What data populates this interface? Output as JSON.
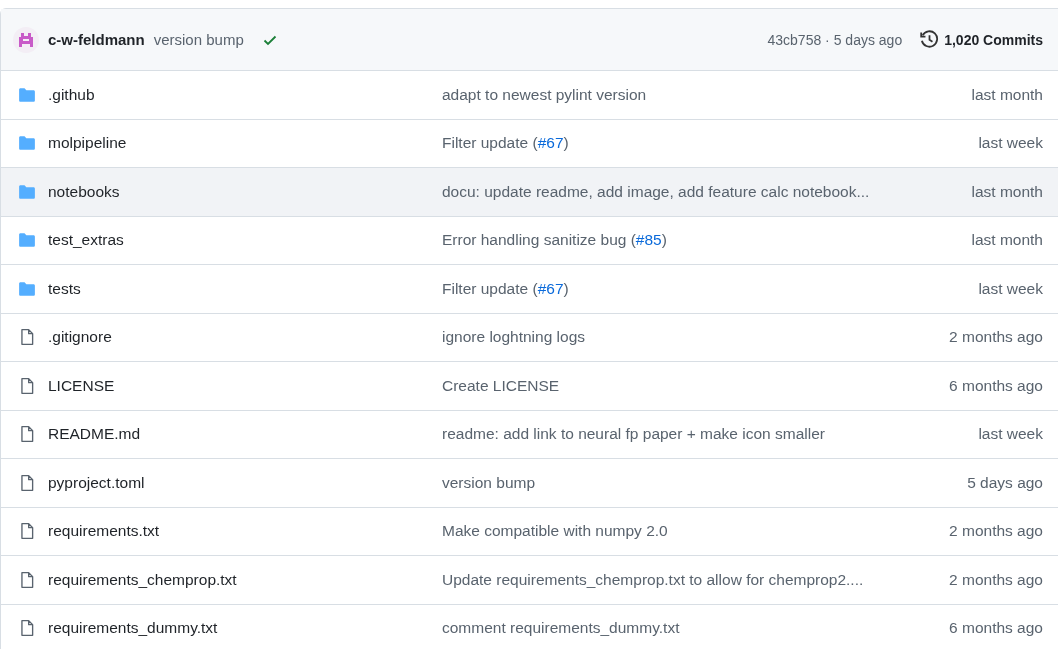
{
  "latest_commit": {
    "author": "c-w-feldmann",
    "message": "version bump",
    "checks_passed": true,
    "hash_and_time": "43cb758 · 5 days ago",
    "commits": "1,020 Commits"
  },
  "files": [
    {
      "kind": "folder",
      "name": ".github",
      "message": "adapt to newest pylint version",
      "time": "last month",
      "hovered": false
    },
    {
      "kind": "folder",
      "name": "molpipeline",
      "message": "Filter update (",
      "link": "#67",
      "message_end": ")",
      "time": "last week",
      "hovered": false
    },
    {
      "kind": "folder",
      "name": "notebooks",
      "message": "docu: update readme, add image, add feature calc notebook...",
      "time": "last month",
      "hovered": true
    },
    {
      "kind": "folder",
      "name": "test_extras",
      "message": "Error handling sanitize bug (",
      "link": "#85",
      "message_end": ")",
      "time": "last month",
      "hovered": false
    },
    {
      "kind": "folder",
      "name": "tests",
      "message": "Filter update (",
      "link": "#67",
      "message_end": ")",
      "time": "last week",
      "hovered": false
    },
    {
      "kind": "file",
      "name": ".gitignore",
      "message": "ignore loghtning logs",
      "time": "2 months ago",
      "hovered": false
    },
    {
      "kind": "file",
      "name": "LICENSE",
      "message": "Create LICENSE",
      "time": "6 months ago",
      "hovered": false
    },
    {
      "kind": "file",
      "name": "README.md",
      "message": "readme: add link to neural fp paper + make icon smaller",
      "time": "last week",
      "hovered": false
    },
    {
      "kind": "file",
      "name": "pyproject.toml",
      "message": "version bump",
      "time": "5 days ago",
      "hovered": false
    },
    {
      "kind": "file",
      "name": "requirements.txt",
      "message": "Make compatible with numpy 2.0",
      "time": "2 months ago",
      "hovered": false
    },
    {
      "kind": "file",
      "name": "requirements_chemprop.txt",
      "message": "Update requirements_chemprop.txt to allow for chemprop2....",
      "time": "2 months ago",
      "hovered": false
    },
    {
      "kind": "file",
      "name": "requirements_dummy.txt",
      "message": "comment requirements_dummy.txt",
      "time": "6 months ago",
      "hovered": false
    }
  ]
}
